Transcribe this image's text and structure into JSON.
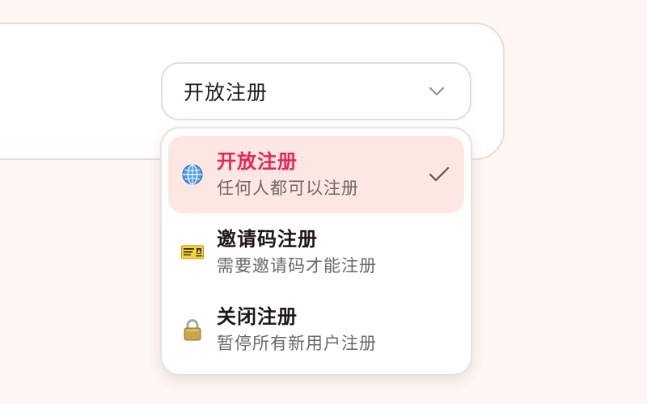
{
  "select": {
    "current_value": "开放注册",
    "icon": "chevron-down-icon"
  },
  "options": [
    {
      "title": "开放注册",
      "description": "任何人都可以注册",
      "icon": "globe-icon",
      "selected": true
    },
    {
      "title": "邀请码注册",
      "description": "需要邀请码才能注册",
      "icon": "ticket-icon",
      "selected": false
    },
    {
      "title": "关闭注册",
      "description": "暂停所有新用户注册",
      "icon": "lock-icon",
      "selected": false
    }
  ],
  "colors": {
    "accent": "#e8245a",
    "selected_bg": "#fde7e3",
    "page_bg": "#fdf6f3"
  }
}
